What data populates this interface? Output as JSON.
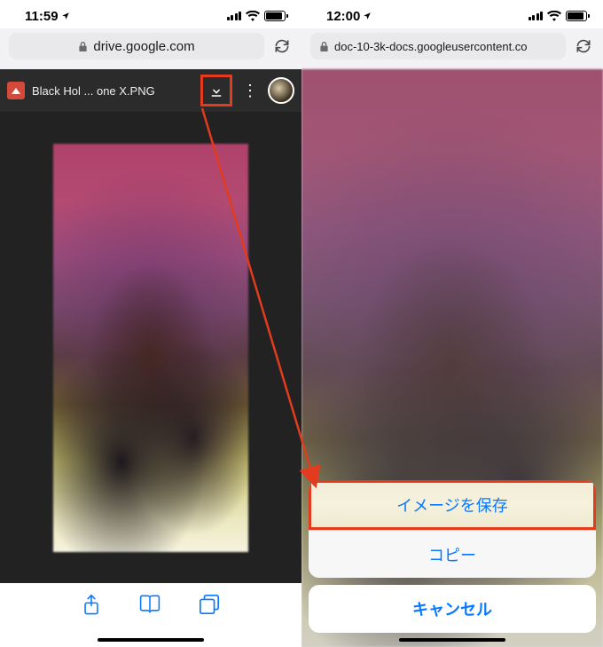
{
  "left": {
    "status": {
      "time": "11:59"
    },
    "url": "drive.google.com",
    "filename": "Black Hol ... one X.PNG"
  },
  "right": {
    "status": {
      "time": "12:00"
    },
    "url": "doc-10-3k-docs.googleusercontent.co",
    "sheet": {
      "save": "イメージを保存",
      "copy": "コピー",
      "cancel": "キャンセル"
    }
  },
  "colors": {
    "highlight": "#e23b1d",
    "ios_blue": "#0879ff"
  }
}
